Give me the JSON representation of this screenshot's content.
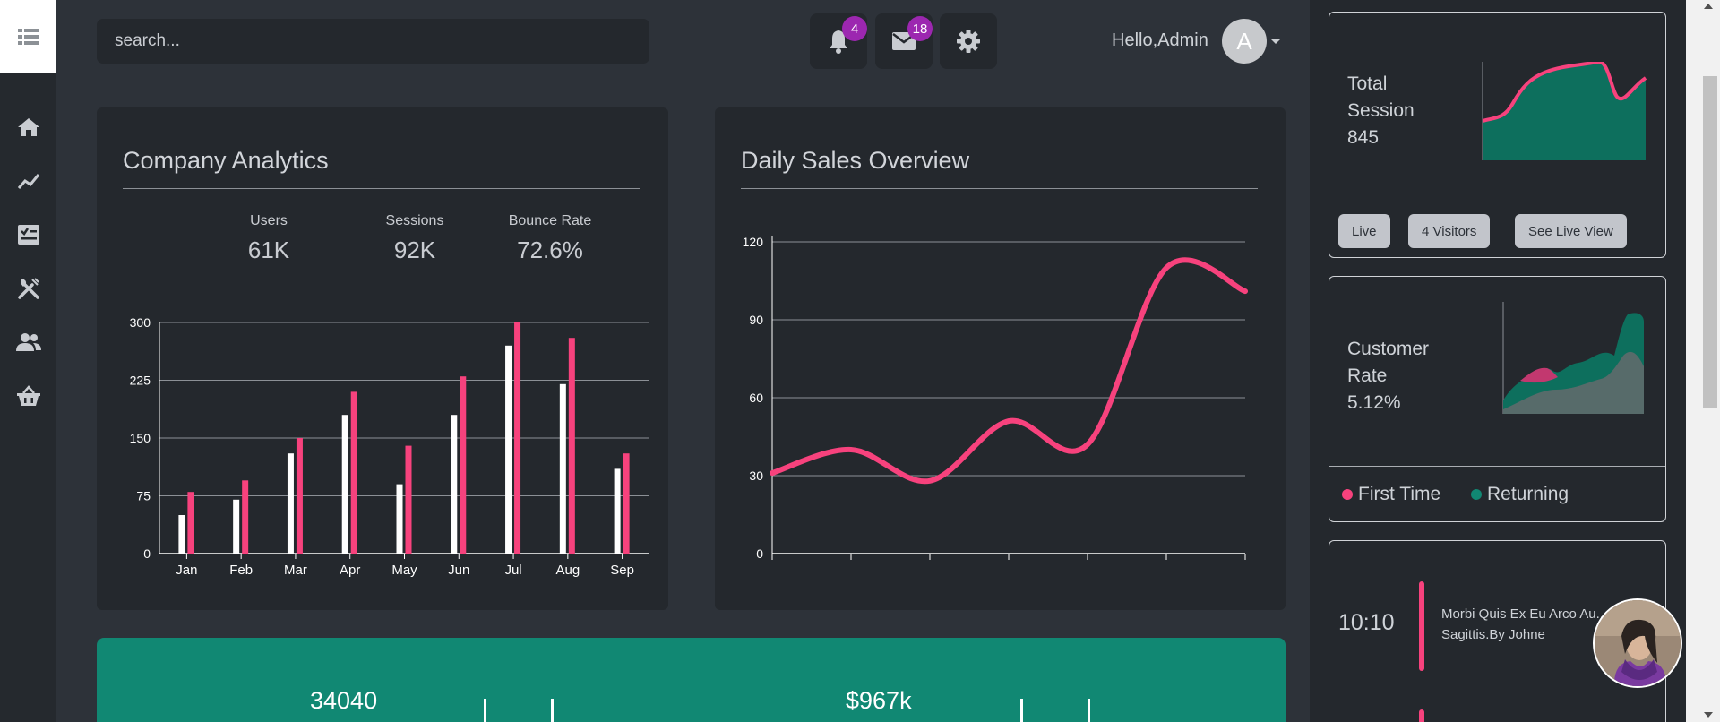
{
  "sidebar": {
    "items": [
      {
        "icon": "home-icon"
      },
      {
        "icon": "trend-line-icon"
      },
      {
        "icon": "checklist-icon"
      },
      {
        "icon": "utensils-icon"
      },
      {
        "icon": "users-icon"
      },
      {
        "icon": "basket-icon"
      }
    ]
  },
  "header": {
    "search_placeholder": "search...",
    "notifications_count": "4",
    "messages_count": "18",
    "greeting": "Hello,Admin",
    "avatar_initial": "A"
  },
  "analytics": {
    "title": "Company Analytics",
    "stats": [
      {
        "label": "Users",
        "value": "61K"
      },
      {
        "label": "Sessions",
        "value": "92K"
      },
      {
        "label": "Bounce Rate",
        "value": "72.6%"
      }
    ]
  },
  "sales": {
    "title": "Daily Sales Overview"
  },
  "right": {
    "session": {
      "label": "Total Session",
      "value": "845",
      "buttons": [
        "Live",
        "4 Visitors",
        "See Live View"
      ]
    },
    "customer": {
      "label": "Customer Rate",
      "value": "5.12%",
      "legend": [
        "First Time",
        "Returning"
      ]
    },
    "timeline": {
      "time": "10:10",
      "text": "Morbi Quis Ex Eu Arco Au...",
      "text2": "Sagittis.By Johne"
    }
  },
  "band": {
    "values": [
      "34040",
      "$967k"
    ]
  },
  "colors": {
    "accent": "#f7427d",
    "teal": "#118873",
    "bar_white": "#ffffff"
  },
  "chart_data": [
    {
      "type": "bar",
      "categories": [
        "Jan",
        "Feb",
        "Mar",
        "Apr",
        "May",
        "Jun",
        "Jul",
        "Aug",
        "Sep"
      ],
      "series": [
        {
          "values": [
            50,
            70,
            130,
            180,
            90,
            180,
            270,
            220,
            110
          ]
        },
        {
          "values": [
            80,
            95,
            150,
            210,
            140,
            230,
            300,
            280,
            130
          ]
        }
      ],
      "yticks": [
        "0",
        "75",
        "150",
        "225",
        "300"
      ],
      "ylim": [
        0,
        300
      ],
      "grid": true
    },
    {
      "type": "line",
      "x": [
        0,
        1,
        2,
        3,
        4,
        5,
        6
      ],
      "values": [
        31,
        40,
        28,
        51,
        42,
        110,
        101
      ],
      "yticks": [
        "0",
        "30",
        "60",
        "90",
        "120"
      ],
      "ylim": [
        0,
        120
      ],
      "grid": true
    }
  ]
}
